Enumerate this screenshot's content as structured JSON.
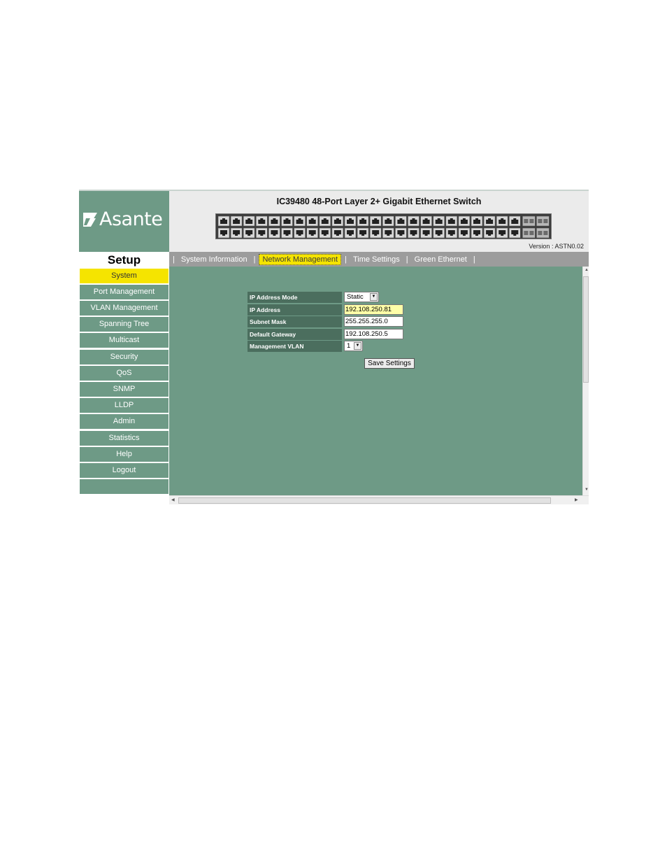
{
  "brand": {
    "name": "Asante"
  },
  "header": {
    "device_title": "IC39480 48-Port Layer 2+ Gigabit Ethernet Switch",
    "version_label": "Version :",
    "version_value": "ASTN0.02",
    "port_count": 48,
    "sfp_count": 4
  },
  "setup_label": "Setup",
  "tabs": [
    {
      "label": "System Information",
      "active": false
    },
    {
      "label": "Network Management",
      "active": true
    },
    {
      "label": "Time Settings",
      "active": false
    },
    {
      "label": "Green Ethernet",
      "active": false
    }
  ],
  "sidebar": {
    "items": [
      {
        "label": "System",
        "active": true
      },
      {
        "label": "Port Management"
      },
      {
        "label": "VLAN Management"
      },
      {
        "label": "Spanning Tree"
      },
      {
        "label": "Multicast"
      },
      {
        "label": "Security"
      },
      {
        "label": "QoS"
      },
      {
        "label": "SNMP"
      },
      {
        "label": "LLDP"
      },
      {
        "label": "Admin"
      },
      {
        "label": "Statistics"
      },
      {
        "label": "Help"
      },
      {
        "label": "Logout"
      }
    ]
  },
  "form": {
    "ip_mode": {
      "label": "IP Address Mode",
      "value": "Static"
    },
    "ip_address": {
      "label": "IP Address",
      "value": "192.108.250.81"
    },
    "subnet": {
      "label": "Subnet Mask",
      "value": "255.255.255.0"
    },
    "gateway": {
      "label": "Default Gateway",
      "value": "192.108.250.5"
    },
    "mgmt_vlan": {
      "label": "Management VLAN",
      "value": "1"
    },
    "save_label": "Save Settings"
  },
  "colors": {
    "panel_green": "#6e9a86",
    "label_green": "#4b6e5e",
    "highlight_yellow": "#f5e400",
    "tab_bar_gray": "#9c9c9c"
  },
  "icons": {
    "logo": "asante-logo-icon",
    "port": "ethernet-port-icon",
    "sfp": "sfp-port-icon",
    "dropdown": "chevron-down-icon"
  }
}
